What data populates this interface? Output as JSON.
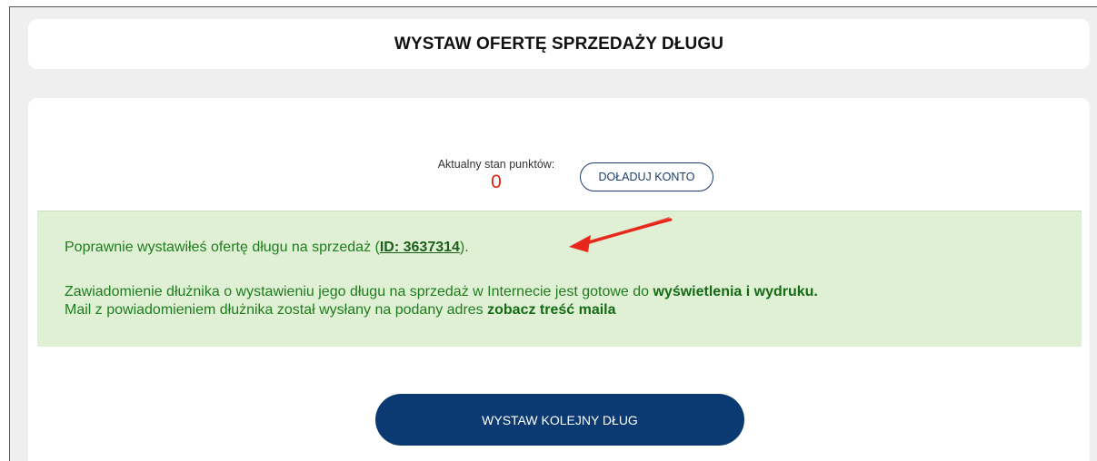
{
  "header": {
    "title": "WYSTAW OFERTĘ SPRZEDAŻY DŁUGU"
  },
  "points": {
    "label": "Aktualny stan punktów:",
    "value": "0",
    "topup_label": "DOŁADUJ KONTO"
  },
  "success": {
    "line1_prefix": "Poprawnie wystawiłeś ofertę długu na sprzedaż (",
    "offer_id_link": "ID: 3637314",
    "line1_suffix": ").",
    "line2_prefix": "Zawiadomienie dłużnika o wystawieniu jego długu na sprzedaż w Internecie jest gotowe do ",
    "line2_link": "wyświetlenia i wydruku.",
    "line3_prefix": "Mail z powiadomieniem dłużnika został wysłany na podany adres ",
    "line3_link": "zobacz treść maila"
  },
  "actions": {
    "next_debt_label": "WYSTAW KOLEJNY DŁUG"
  },
  "colors": {
    "primary": "#0b3a72",
    "success_bg": "#e0f0d4",
    "success_text": "#1e7d1e",
    "points_value": "#d9240f",
    "annotation_arrow": "#e8261a"
  }
}
